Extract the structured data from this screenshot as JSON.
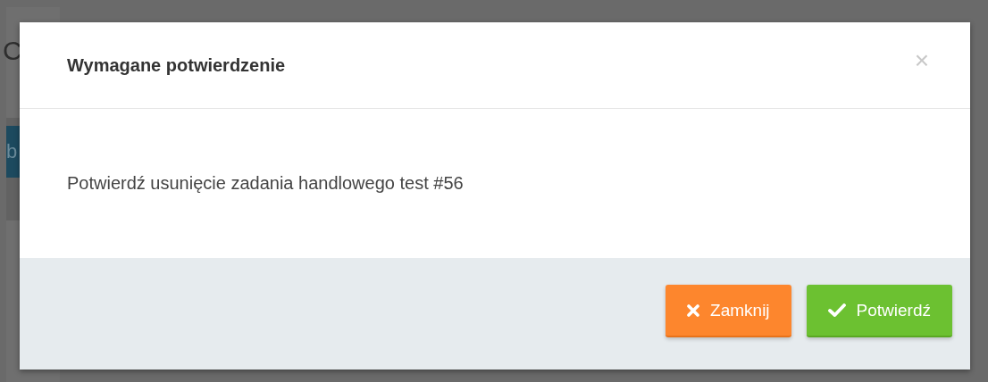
{
  "background": {
    "heading_fragment": "C",
    "button_fragment": "b"
  },
  "dialog": {
    "title": "Wymagane potwierdzenie",
    "close": "×",
    "message": "Potwierdź usunięcie zadania handlowego test #56",
    "buttons": [
      {
        "kind": "cancel",
        "label": "Zamknij"
      },
      {
        "kind": "confirm",
        "label": "Potwierdź"
      }
    ]
  }
}
